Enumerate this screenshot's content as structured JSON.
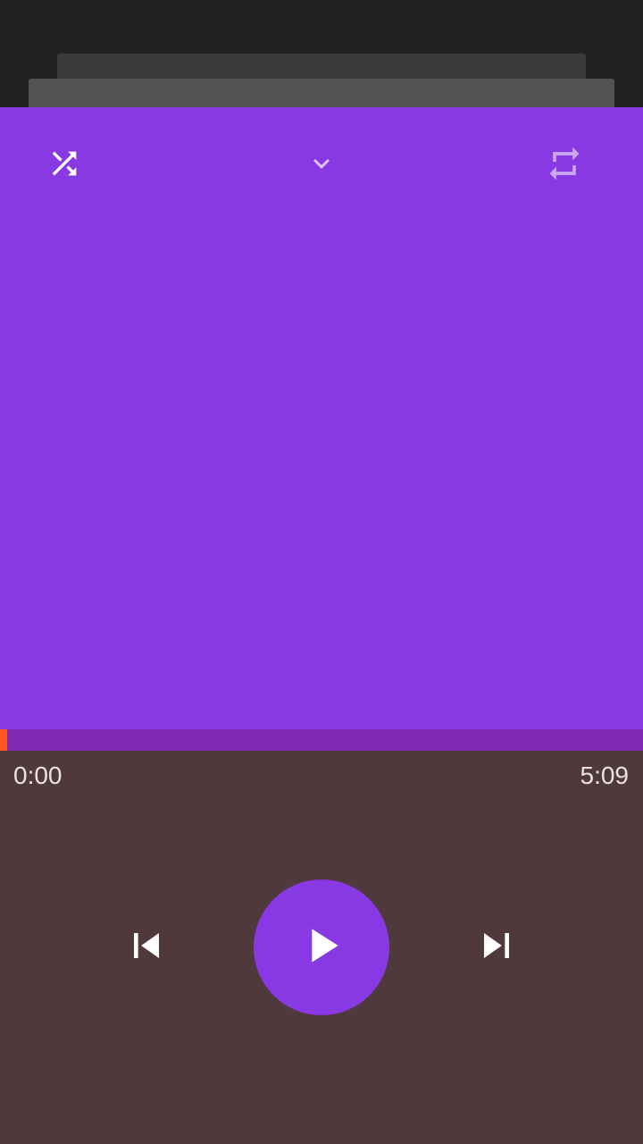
{
  "player": {
    "elapsed": "0:00",
    "duration": "5:09",
    "progress_fraction": 0.0
  },
  "icons": {
    "shuffle": "shuffle-icon",
    "collapse": "chevron-down-icon",
    "repeat": "repeat-icon",
    "previous": "skip-previous-icon",
    "play": "play-icon",
    "next": "skip-next-icon"
  },
  "colors": {
    "accent": "#8839e3",
    "progress": "#ff5722",
    "progress_track": "#7f2bb5",
    "controls_background": "#50393c"
  }
}
